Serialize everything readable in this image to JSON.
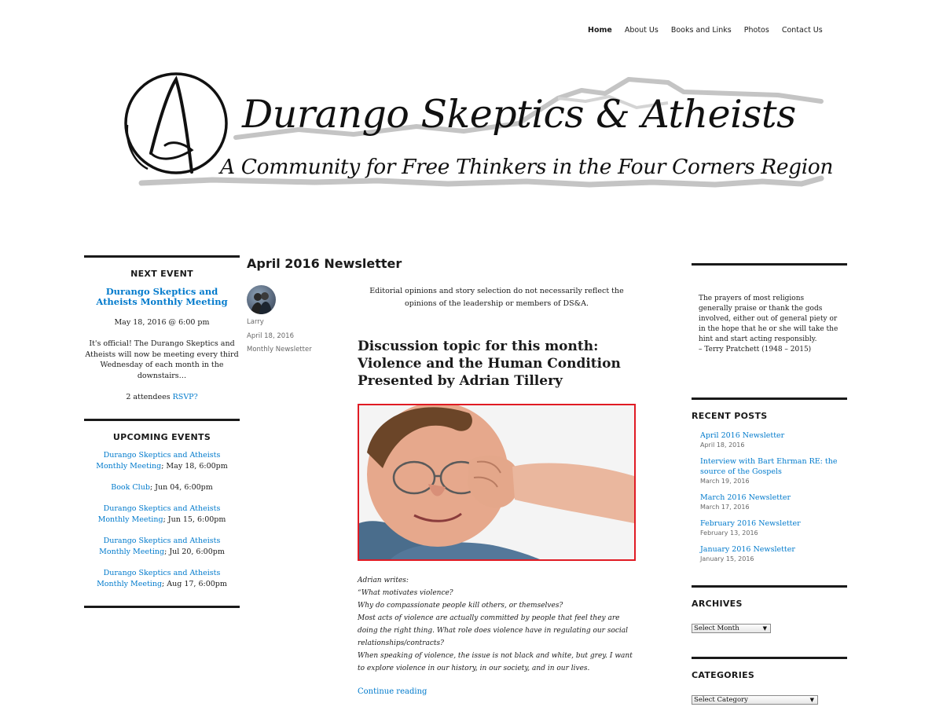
{
  "nav": {
    "items": [
      {
        "label": "Home",
        "active": true
      },
      {
        "label": "About Us",
        "active": false
      },
      {
        "label": "Books and Links",
        "active": false
      },
      {
        "label": "Photos",
        "active": false
      },
      {
        "label": "Contact Us",
        "active": false
      }
    ]
  },
  "header": {
    "logo_letter": "A",
    "title": "Durango Skeptics & Atheists",
    "tagline": "A Community for Free Thinkers in the Four Corners Region"
  },
  "next_event": {
    "heading": "NEXT EVENT",
    "title": "Durango Skeptics and Atheists Monthly Meeting",
    "date": "May 18, 2016 @ 6:00 pm",
    "description": "It's official! The Durango Skeptics and Atheists will now be meeting every third Wednesday of each month in the downstairs…",
    "attendees": "2 attendees",
    "rsvp": "RSVP?"
  },
  "upcoming_events": {
    "heading": "UPCOMING EVENTS",
    "items": [
      {
        "link": "Durango Skeptics and Atheists Monthly Meeting",
        "when": "; May 18, 6:00pm"
      },
      {
        "link": "Book Club",
        "when": "; Jun 04, 6:00pm"
      },
      {
        "link": "Durango Skeptics and Atheists Monthly Meeting",
        "when": "; Jun 15, 6:00pm"
      },
      {
        "link": "Durango Skeptics and Atheists Monthly Meeting",
        "when": "; Jul 20, 6:00pm"
      },
      {
        "link": "Durango Skeptics and Atheists Monthly Meeting",
        "when": "; Aug 17, 6:00pm"
      }
    ]
  },
  "post": {
    "title": "April 2016 Newsletter",
    "author": "Larry",
    "date": "April 18, 2016",
    "category": "Monthly Newsletter",
    "editorial_note": "Editorial opinions and story selection do not necessarily reflect the opinions of the leadership or members of DS&A.",
    "discussion_heading": "Discussion topic for this month: Violence and the Human Condition Presented by Adrian Tillery",
    "body_lines": [
      "Adrian writes:",
      "“What motivates violence?",
      "Why do compassionate people kill others, or themselves?",
      "Most acts of violence are actually committed by people that feel they are doing the right thing.  What role does violence have in regulating our social relationships/contracts?",
      "When speaking of violence, the issue is not black and white, but grey.  I want to explore violence in our history, in our society, and in our lives."
    ],
    "continue_label": "Continue reading"
  },
  "quote": {
    "text": "The prayers of most religions generally praise or thank the gods involved, either out of general piety or in the hope that he or she will take the hint and start acting responsibly.",
    "attribution": "– Terry Pratchett (1948 – 2015)"
  },
  "recent_posts": {
    "heading": "RECENT POSTS",
    "items": [
      {
        "title": "April 2016 Newsletter",
        "date": "April 18, 2016"
      },
      {
        "title": "Interview with Bart Ehrman RE: the source of the Gospels",
        "date": "March 19, 2016"
      },
      {
        "title": "March 2016 Newsletter",
        "date": "March 17, 2016"
      },
      {
        "title": "February 2016 Newsletter",
        "date": "February 13, 2016"
      },
      {
        "title": "January 2016 Newsletter",
        "date": "January 15, 2016"
      }
    ]
  },
  "archives": {
    "heading": "ARCHIVES",
    "select_value": "Select Month"
  },
  "categories": {
    "heading": "CATEGORIES",
    "select_value": "Select Category"
  },
  "colors": {
    "link": "#007acc",
    "image_border": "#e01b24",
    "text": "#1a1a1a"
  }
}
